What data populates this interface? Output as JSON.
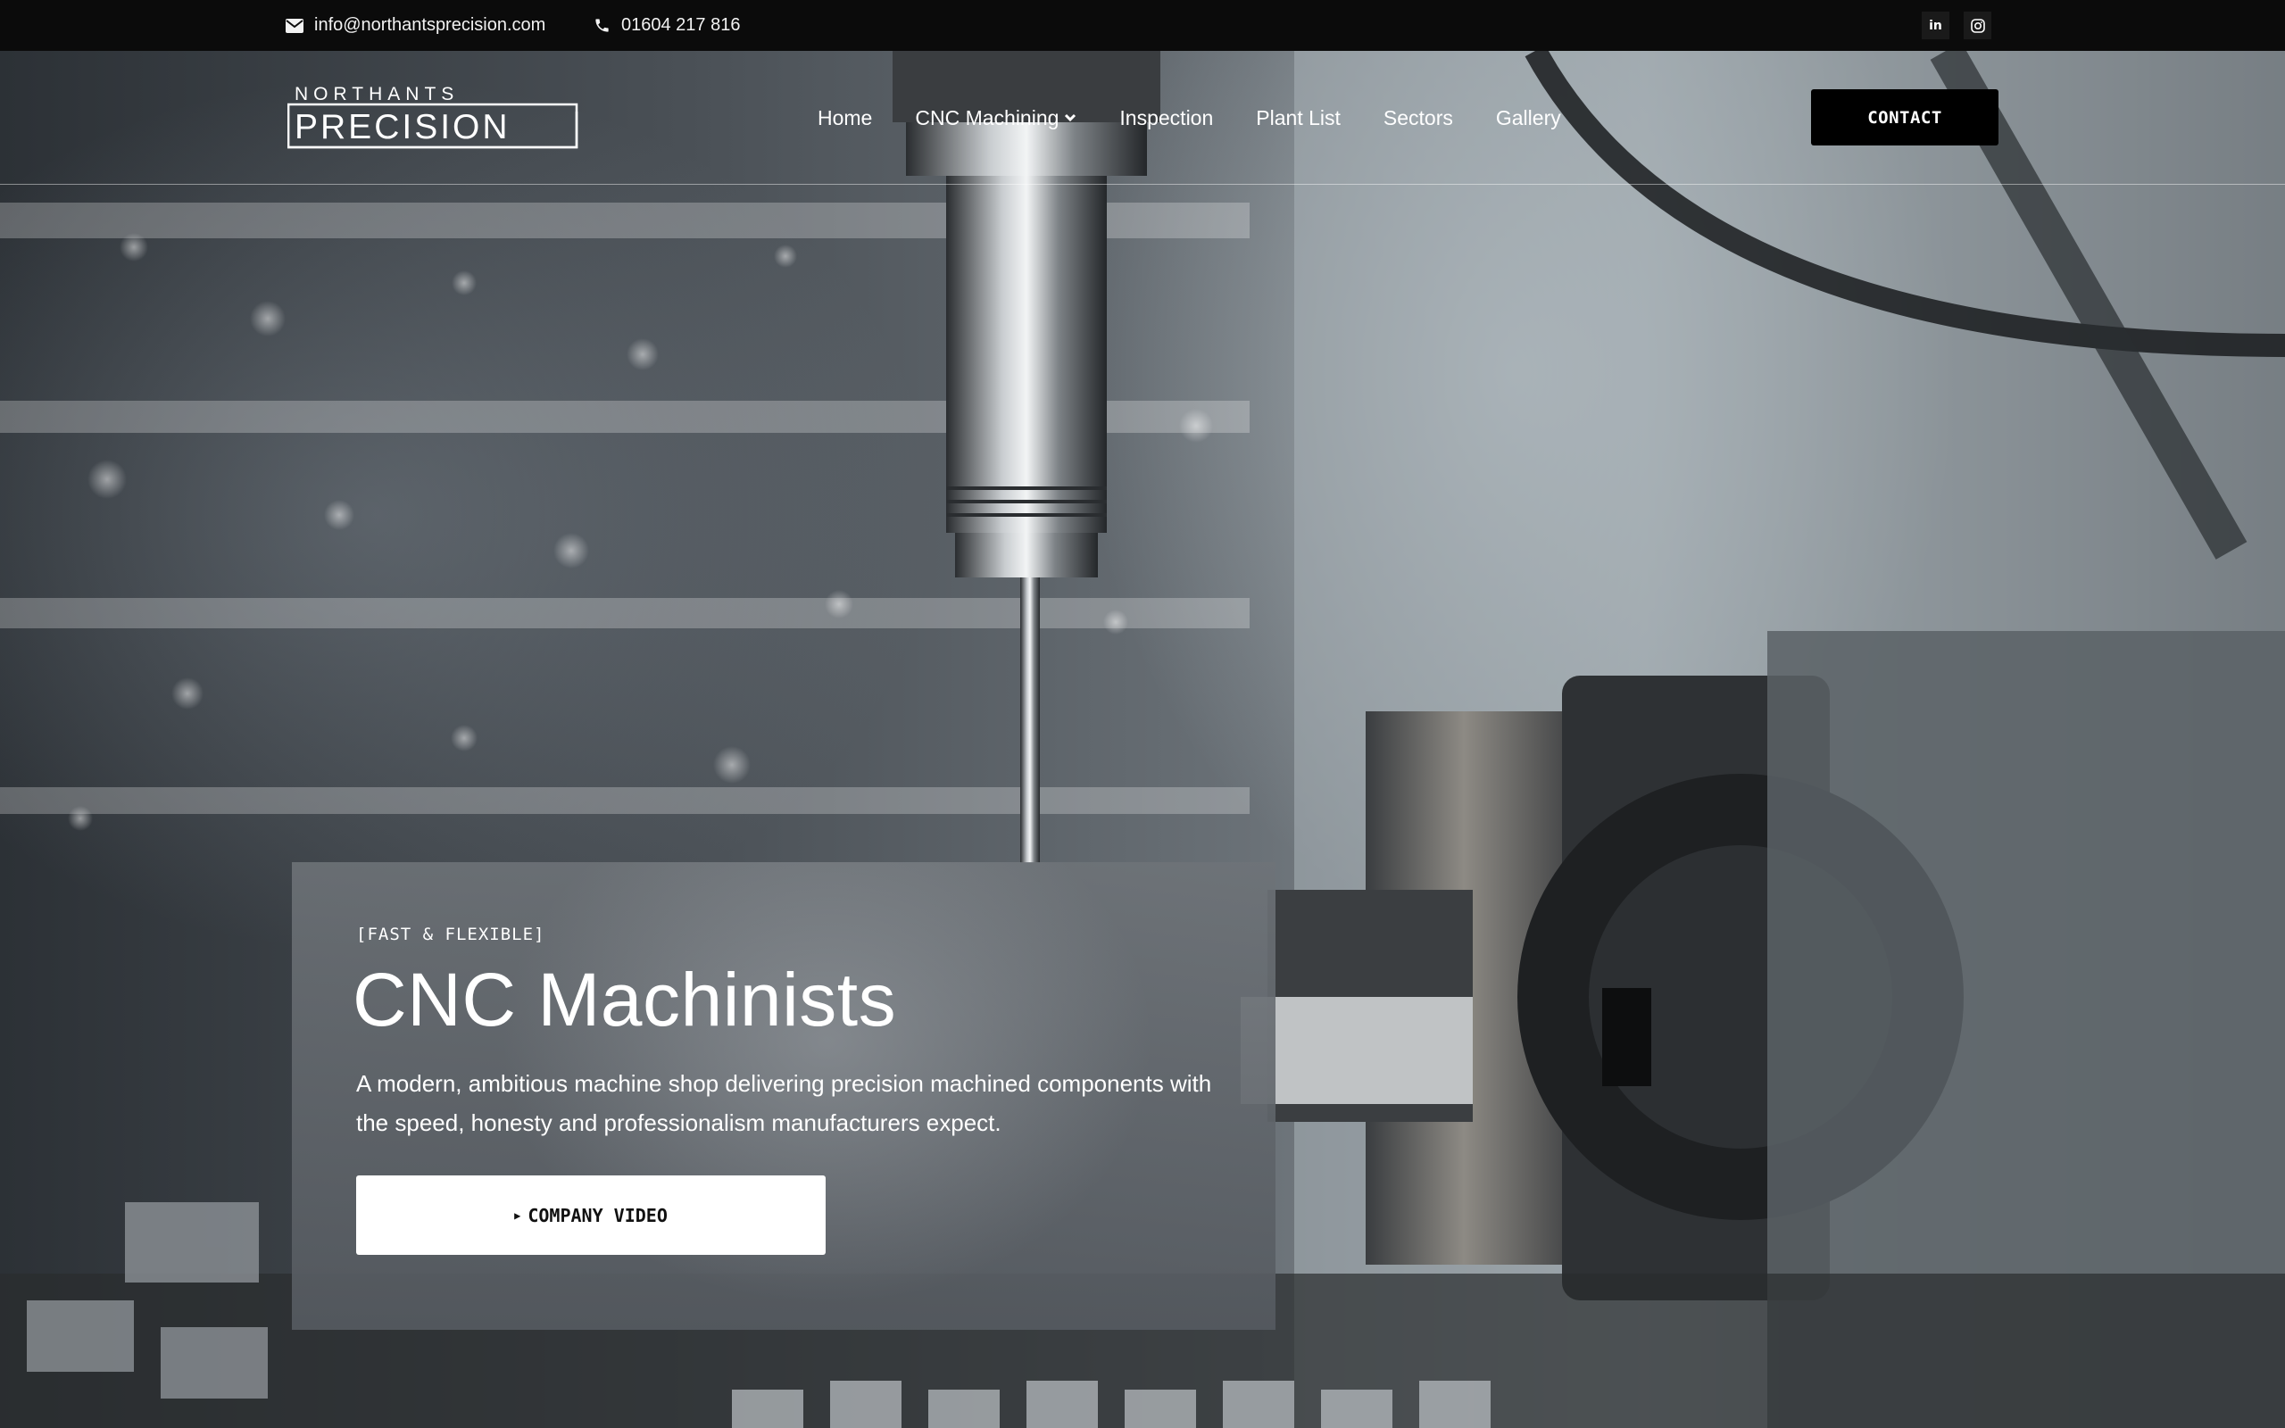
{
  "topbar": {
    "email": "info@northantsprecision.com",
    "phone": "01604 217 816",
    "social": {
      "linkedin_label": "in"
    }
  },
  "header": {
    "logo": {
      "line1": "NORTHANTS",
      "line2": "PRECISION"
    },
    "nav": [
      {
        "label": "Home"
      },
      {
        "label": "CNC Machining",
        "has_dropdown": true
      },
      {
        "label": "Inspection"
      },
      {
        "label": "Plant List"
      },
      {
        "label": "Sectors"
      },
      {
        "label": "Gallery"
      }
    ],
    "contact_label": "CONTACT"
  },
  "hero": {
    "eyebrow": "[FAST & FLEXIBLE]",
    "title": "CNC Machinists",
    "description": "A modern, ambitious machine shop delivering precision machined components with the speed, honesty and professionalism manufacturers expect.",
    "video_button_label": "COMPANY VIDEO"
  },
  "colors": {
    "topbar_bg": "#0b0b0b",
    "contact_button_bg": "#000000",
    "video_button_bg": "#ffffff",
    "text": "#ffffff"
  },
  "icons": [
    "envelope-icon",
    "phone-icon",
    "linkedin-icon",
    "instagram-icon",
    "chevron-down-icon",
    "play-icon"
  ]
}
